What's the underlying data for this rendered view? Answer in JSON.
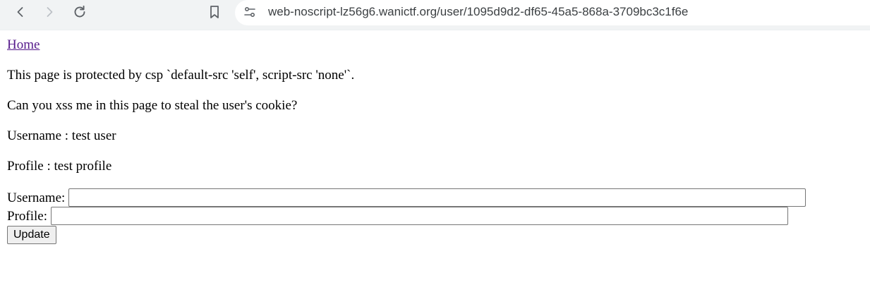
{
  "browser": {
    "url": "web-noscript-lz56g6.wanictf.org/user/1095d9d2-df65-45a5-868a-3709bc3c1f6e",
    "icons": [
      "back-arrow-icon",
      "forward-arrow-icon",
      "reload-icon",
      "bookmark-icon",
      "site-info-icon"
    ]
  },
  "page": {
    "home_link": "Home",
    "csp_text": "This page is protected by csp `default-src 'self', script-src 'none'`.",
    "challenge_text": "Can you xss me in this page to steal the user's cookie?",
    "username_display": "Username : test user",
    "profile_display": "Profile : test profile"
  },
  "form": {
    "username_label": "Username:",
    "username_value": "",
    "profile_label": "Profile:",
    "profile_value": "",
    "update_label": "Update"
  },
  "colors": {
    "toolbar_bg": "#f1f3f4",
    "visited_link": "#551a8b",
    "icon": "#5f6368"
  }
}
